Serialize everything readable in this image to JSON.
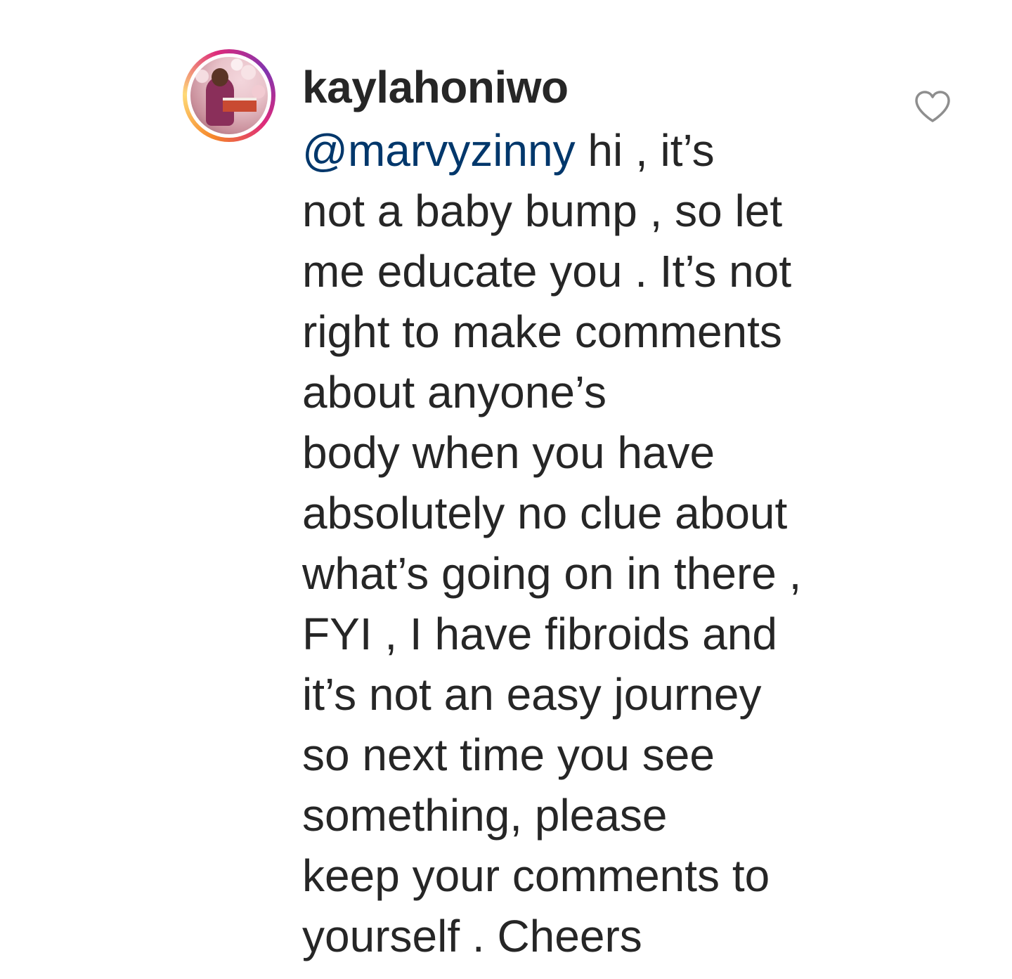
{
  "comment": {
    "username": "kaylahoniwo",
    "mention": "@marvyzinny",
    "lines": [
      "  hi , it’s",
      "not a baby bump , so let",
      "me educate you . It’s not",
      "right to make comments",
      "about anyone’s",
      "body when you have",
      "absolutely no clue about",
      "what’s going on in there ,",
      "FYI , I have fibroids and",
      "it’s not an easy journey",
      "so next time you see",
      "something, please",
      "keep your comments to",
      "yourself . Cheers"
    ]
  },
  "icons": {
    "like": "heart-outline-icon",
    "avatar": "profile-avatar"
  },
  "colors": {
    "text": "#262626",
    "mention": "#00376b",
    "icon": "#8e8e8e",
    "story_ring": [
      "#f58529",
      "#feda77",
      "#dd2a7b",
      "#8134af"
    ]
  }
}
